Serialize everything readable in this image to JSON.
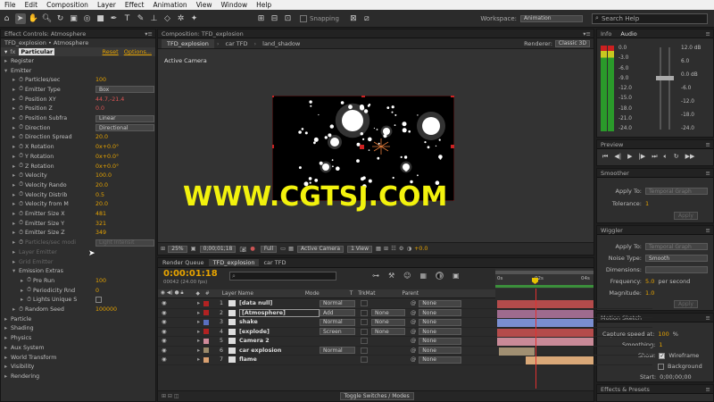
{
  "menu": [
    "File",
    "Edit",
    "Composition",
    "Layer",
    "Effect",
    "Animation",
    "View",
    "Window",
    "Help"
  ],
  "toolbar": {
    "snapping": "Snapping",
    "workspace_label": "Workspace:",
    "workspace_value": "Animation",
    "search_placeholder": "Search Help"
  },
  "effect_controls": {
    "header": "Effect Controls: Atmosphere",
    "subtitle": "TFD_explosion • Atmosphere",
    "effect_name": "Particular",
    "reset": "Reset",
    "options": "Options...",
    "rows": [
      {
        "label": "Register",
        "kind": "group",
        "indent": 1
      },
      {
        "label": "Emitter",
        "kind": "group-open",
        "indent": 1
      },
      {
        "label": "Particles/sec",
        "value": "100",
        "indent": 2
      },
      {
        "label": "Emitter Type",
        "dropdown": "Box",
        "indent": 2
      },
      {
        "label": "Position XY",
        "value": "44.7,-21.4",
        "indent": 2,
        "red": true
      },
      {
        "label": "Position Z",
        "value": "0.0",
        "indent": 2,
        "red": true
      },
      {
        "label": "Position Subfra",
        "dropdown": "Linear",
        "indent": 2
      },
      {
        "label": "Direction",
        "dropdown": "Directional",
        "indent": 2
      },
      {
        "label": "Direction Spread",
        "value": "20.0",
        "indent": 2
      },
      {
        "label": "X Rotation",
        "value": "0x+0.0°",
        "indent": 2
      },
      {
        "label": "Y Rotation",
        "value": "0x+0.0°",
        "indent": 2
      },
      {
        "label": "Z Rotation",
        "value": "0x+0.0°",
        "indent": 2
      },
      {
        "label": "Velocity",
        "value": "100.0",
        "indent": 2
      },
      {
        "label": "Velocity Rando",
        "value": "20.0",
        "indent": 2
      },
      {
        "label": "Velocity Distrib",
        "value": "0.5",
        "indent": 2
      },
      {
        "label": "Velocity from M",
        "value": "20.0",
        "indent": 2
      },
      {
        "label": "Emitter Size X",
        "value": "481",
        "indent": 2
      },
      {
        "label": "Emitter Size Y",
        "value": "321",
        "indent": 2
      },
      {
        "label": "Emitter Size Z",
        "value": "349",
        "indent": 2
      },
      {
        "label": "Particles/sec modi",
        "dropdown": "Light Intensit",
        "indent": 2,
        "dim": true
      },
      {
        "label": "Layer Emitter",
        "kind": "group",
        "indent": 2,
        "dim": true
      },
      {
        "label": "Grid Emitter",
        "kind": "group",
        "indent": 2,
        "dim": true
      },
      {
        "label": "Emission Extras",
        "kind": "group-open",
        "indent": 2
      },
      {
        "label": "Pre Run",
        "value": "100",
        "indent": 3
      },
      {
        "label": "Periodicity Rnd",
        "value": "0",
        "indent": 3
      },
      {
        "label": "Lights Unique S",
        "check": true,
        "indent": 3
      },
      {
        "label": "Random Seed",
        "value": "100000",
        "indent": 2
      },
      {
        "label": "Particle",
        "kind": "group",
        "indent": 1
      },
      {
        "label": "Shading",
        "kind": "group",
        "indent": 1
      },
      {
        "label": "Physics",
        "kind": "group",
        "indent": 1
      },
      {
        "label": "Aux System",
        "kind": "group",
        "indent": 1
      },
      {
        "label": "World Transform",
        "kind": "group",
        "indent": 1
      },
      {
        "label": "Visibility",
        "kind": "group",
        "indent": 1
      },
      {
        "label": "Rendering",
        "kind": "group",
        "indent": 1
      }
    ]
  },
  "composition": {
    "header": "Composition: TFD_explosion",
    "tabs": [
      "TFD_explosion",
      "car TFD",
      "land_shadow"
    ],
    "renderer_label": "Renderer:",
    "renderer_value": "Classic 3D",
    "camera_label": "Active Camera",
    "zoom": "25%",
    "timecode": "0;00;01;18",
    "resolution": "Full",
    "view_camera": "Active Camera",
    "views": "1 View",
    "exposure": "+0.0"
  },
  "audio": {
    "tabs": [
      "Info",
      "Audio"
    ],
    "left_scale": [
      "0.0",
      "-3.0",
      "-6.0",
      "-9.0",
      "-12.0",
      "-15.0",
      "-18.0",
      "-21.0",
      "-24.0"
    ],
    "right_scale": [
      "12.0 dB",
      "6.0",
      "0.0 dB",
      "-6.0",
      "-12.0",
      "-18.0",
      "-24.0"
    ]
  },
  "preview": {
    "title": "Preview"
  },
  "smoother": {
    "title": "Smoother",
    "apply_label": "Apply To:",
    "apply_value": "Temporal Graph",
    "tolerance_label": "Tolerance:",
    "tolerance_value": "1",
    "apply_button": "Apply"
  },
  "wiggler": {
    "title": "Wiggler",
    "apply_label": "Apply To:",
    "apply_value": "Temporal Graph",
    "noise_label": "Noise Type:",
    "noise_value": "Smooth",
    "dims_label": "Dimensions:",
    "freq_label": "Frequency:",
    "freq_value": "5.0",
    "freq_unit": "per second",
    "mag_label": "Magnitude:",
    "mag_value": "1.0",
    "apply_button": "Apply"
  },
  "motion_sketch": {
    "title": "Motion Sketch",
    "capture_label": "Capture speed at:",
    "capture_value": "100",
    "capture_unit": "%",
    "smoothing_label": "Smoothing:",
    "smoothing_value": "1",
    "show_label": "Show:",
    "wireframe": "Wireframe",
    "background": "Background",
    "start_label": "Start:",
    "start_value": "0;00;00;00"
  },
  "effects_presets": {
    "title": "Effects & Presets"
  },
  "timeline": {
    "tabs": [
      "Render Queue",
      "TFD_explosion",
      "car TFD"
    ],
    "timecode": "0:00:01:18",
    "frames": "00042 (24.00 fps)",
    "columns": {
      "layer_name": "Layer Name",
      "mode": "Mode",
      "t": "T",
      "trkmat": "TrkMat",
      "parent": "Parent"
    },
    "ruler": [
      "0s",
      "02s",
      "04s"
    ],
    "toggle": "Toggle Switches / Modes",
    "layers": [
      {
        "num": "1",
        "name": "[data null]",
        "mode": "Normal",
        "trk": "",
        "parent": "None",
        "color": "#b22222",
        "bar": "#b44b4b"
      },
      {
        "num": "2",
        "name": "[Atmosphere]",
        "mode": "Add",
        "trk": "None",
        "parent": "None",
        "color": "#b22222",
        "bar": "#9f6b8e"
      },
      {
        "num": "3",
        "name": "shake",
        "mode": "Normal",
        "trk": "None",
        "parent": "None",
        "color": "#5a6fc0",
        "bar": "#7a8ed0"
      },
      {
        "num": "4",
        "name": "[explode]",
        "mode": "Screen",
        "trk": "None",
        "parent": "None",
        "color": "#b22222",
        "bar": "#b44b4b"
      },
      {
        "num": "5",
        "name": "Camera 2",
        "mode": "",
        "trk": "",
        "parent": "None",
        "color": "#d08a9a",
        "bar": "#c98a98"
      },
      {
        "num": "6",
        "name": "car explosion",
        "mode": "Normal",
        "trk": "",
        "parent": "None",
        "color": "#9a8a6a",
        "bar": "#a08f72"
      },
      {
        "num": "7",
        "name": "flame",
        "mode": "",
        "trk": "",
        "parent": "None",
        "color": "#d9a070",
        "bar": "#d9a878"
      }
    ]
  },
  "watermark": "WWW.CGTSJ.COM"
}
